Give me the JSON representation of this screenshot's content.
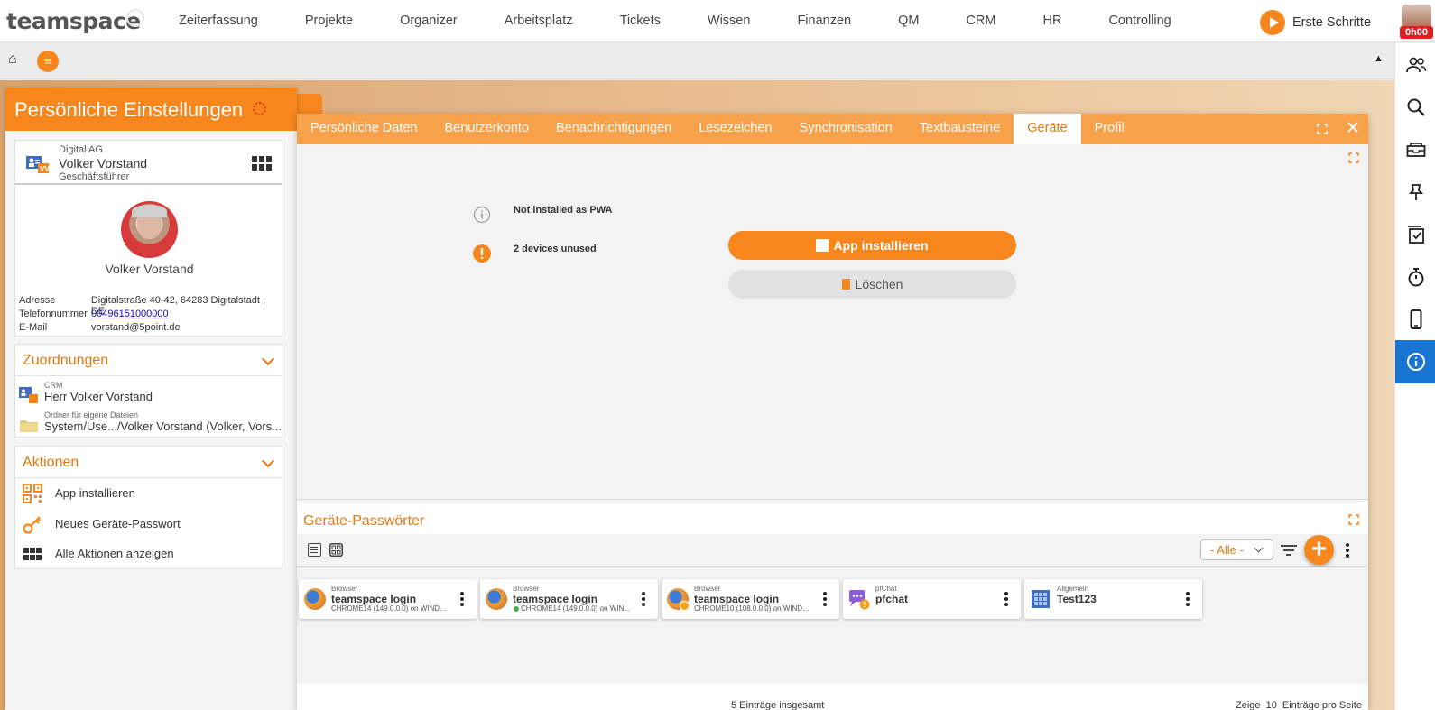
{
  "topbar": {
    "logo": "teamspace",
    "nav": [
      "Zeiterfassung",
      "Projekte",
      "Organizer",
      "Arbeitsplatz",
      "Tickets",
      "Wissen",
      "Finanzen",
      "QM",
      "CRM",
      "HR",
      "Controlling"
    ],
    "first_steps": "Erste Schritte",
    "timer": "0h00"
  },
  "left_panel": {
    "title": "Persönliche Einstellungen",
    "user": {
      "company": "Digital AG",
      "name": "Volker Vorstand",
      "role": "Geschäftsführer",
      "display_name": "Volker Vorstand",
      "address_label": "Adresse",
      "address": "Digitalstraße 40-42, 64283 Digitalstadt , DE",
      "phone_label": "Telefonnummer",
      "phone": "00496151000000",
      "email_label": "E-Mail",
      "email": "vorstand@5point.de"
    },
    "assignments": {
      "title": "Zuordnungen",
      "items": [
        {
          "small": "CRM",
          "main": "Herr Volker Vorstand"
        },
        {
          "small": "Ordner für eigene Dateien",
          "main": "System/Use.../Volker Vorstand (Volker, Vors..."
        }
      ]
    },
    "actions": {
      "title": "Aktionen",
      "items": [
        "App installieren",
        "Neues Geräte-Passwort",
        "Alle Aktionen anzeigen"
      ]
    }
  },
  "dialog": {
    "tabs": [
      "Persönliche Daten",
      "Benutzerkonto",
      "Benachrichtigungen",
      "Lesezeichen",
      "Synchronisation",
      "Textbausteine",
      "Geräte",
      "Profil"
    ],
    "active_tab": "Geräte",
    "status_pwa": "Not installed as PWA",
    "status_devices": "2 devices unused",
    "install_button": "App installieren",
    "delete_button": "Löschen",
    "lower_title": "Geräte-Passwörter",
    "filter_value": "- Alle -",
    "cards": [
      {
        "cat": "Browser",
        "name": "teamspace login",
        "sub": "CHROME14 (149.0.0.0) on WINDO..."
      },
      {
        "cat": "Browser",
        "name": "teamspace login",
        "sub": "CHROME14 (149.0.0.0) on WIN..."
      },
      {
        "cat": "Browser",
        "name": "teamspace login",
        "sub": "CHROME10 (108.0.0.0) on WINDO..."
      },
      {
        "cat": "pfChat",
        "name": "pfchat",
        "sub": ""
      },
      {
        "cat": "Allgemein",
        "name": "Test123",
        "sub": ""
      }
    ],
    "total": "5 Einträge insgesamt",
    "page_show": "Zeige",
    "page_size": "10",
    "page_suffix": "Einträge pro Seite"
  },
  "colors": {
    "accent": "#f7871d",
    "accent_text": "#e07a10",
    "active_rail": "#1976d2"
  }
}
